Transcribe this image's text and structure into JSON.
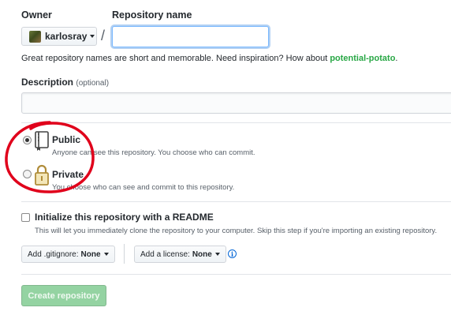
{
  "owner": {
    "label": "Owner",
    "username": "karlosray"
  },
  "repository": {
    "label": "Repository name",
    "name_value": "",
    "separator": "/",
    "hint_prefix": "Great repository names are short and memorable. Need inspiration? How about ",
    "suggestion": "potential-potato",
    "hint_suffix": "."
  },
  "description": {
    "label": "Description",
    "optional_tag": "(optional)",
    "value": ""
  },
  "visibility": {
    "selected": "public",
    "public": {
      "title": "Public",
      "description": "Anyone can see this repository. You choose who can commit.",
      "icon": "repo-book-icon"
    },
    "private": {
      "title": "Private",
      "description": "You choose who can see and commit to this repository.",
      "icon": "lock-icon"
    }
  },
  "initialize": {
    "checked": false,
    "title": "Initialize this repository with a README",
    "description": "This will let you immediately clone the repository to your computer. Skip this step if you're importing an existing repository."
  },
  "options": {
    "gitignore_label": "Add .gitignore:",
    "gitignore_value": "None",
    "license_label": "Add a license:",
    "license_value": "None",
    "info_glyph": "i"
  },
  "submit": {
    "label": "Create repository",
    "disabled": true
  },
  "colors": {
    "accent_green": "#28a745",
    "button_green_disabled": "#94d3a2",
    "annotation_red": "#e0001b",
    "focus_blue": "#79b8ff",
    "info_blue": "#0366d6"
  }
}
